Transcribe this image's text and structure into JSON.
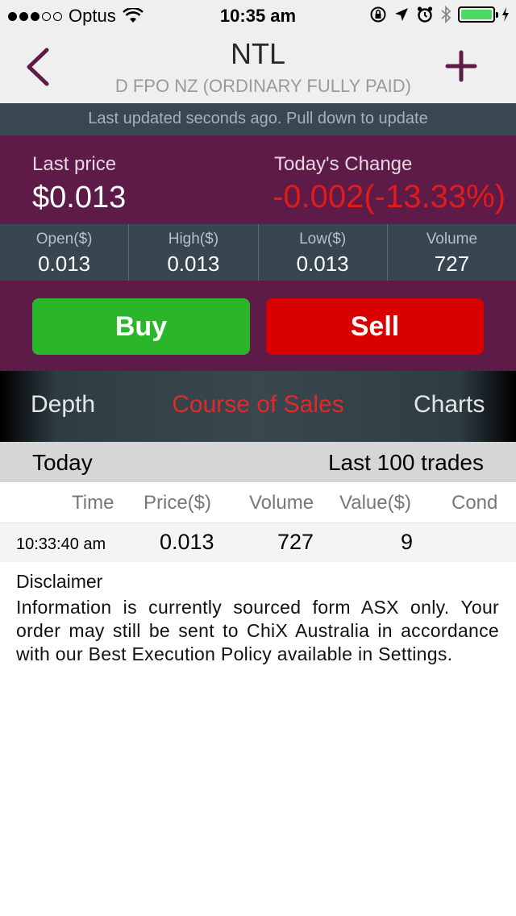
{
  "status_bar": {
    "carrier": "Optus",
    "time": "10:35 am",
    "signal_icon": "signal-dots-icon",
    "wifi_icon": "wifi-icon",
    "battery_color": "#4cd964"
  },
  "nav": {
    "title": "NTL",
    "subtitle": "D FPO NZ (ORDINARY FULLY PAID)",
    "back_icon": "chevron-left-icon",
    "add_icon": "plus-icon"
  },
  "update_text": "Last updated seconds ago. Pull down to update",
  "quote": {
    "last_price_label": "Last price",
    "last_price": "$0.013",
    "change_label": "Today's Change",
    "change": "-0.002(-13.33%)"
  },
  "stats": [
    {
      "label": "Open($)",
      "value": "0.013"
    },
    {
      "label": "High($)",
      "value": "0.013"
    },
    {
      "label": "Low($)",
      "value": "0.013"
    },
    {
      "label": "Volume",
      "value": "727"
    }
  ],
  "actions": {
    "buy": "Buy",
    "sell": "Sell"
  },
  "tabs": {
    "depth": "Depth",
    "course_of_sales": "Course of Sales",
    "charts": "Charts"
  },
  "trades": {
    "period": "Today",
    "count_label": "Last 100 trades",
    "columns": [
      "Time",
      "Price($)",
      "Volume",
      "Value($)",
      "Cond"
    ],
    "rows": [
      {
        "time": "10:33:40 am",
        "price": "0.013",
        "volume": "727",
        "value": "9",
        "cond": ""
      }
    ]
  },
  "disclaimer": {
    "title": "Disclaimer",
    "body": "Information is currently sourced form ASX only. Your order may still be sent to ChiX Australia in accordance with our Best Execution Policy available in Settings."
  },
  "colors": {
    "brand": "#5e1b48",
    "panel": "#374650",
    "buy": "#2bb62a",
    "sell": "#d90000",
    "negative": "#e11a1a"
  }
}
